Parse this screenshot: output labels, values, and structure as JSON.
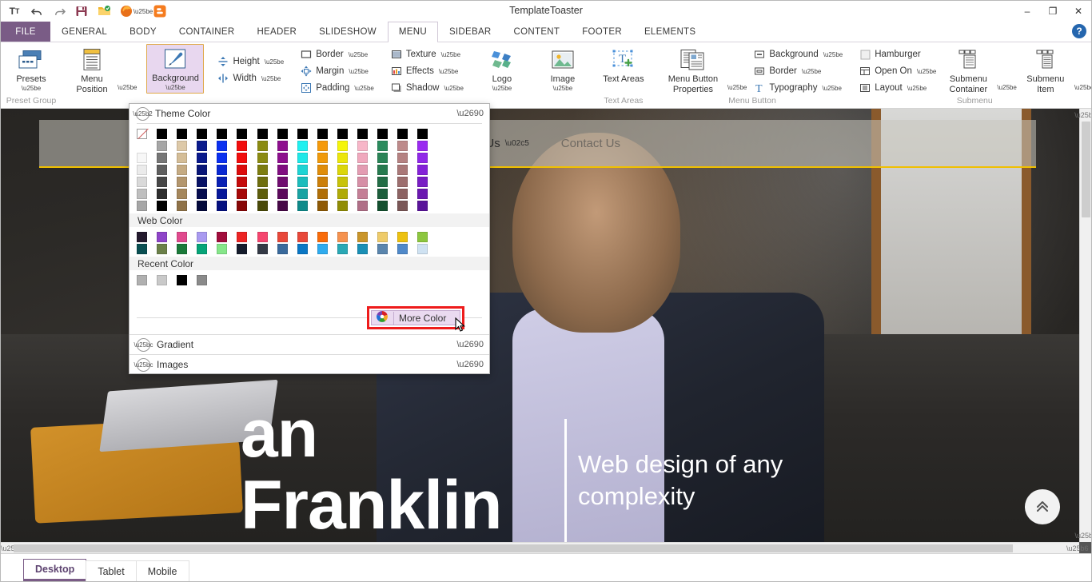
{
  "window": {
    "title": "TemplateToaster",
    "minimize": "–",
    "restore": "❐",
    "close": "✕",
    "help": "?"
  },
  "quick_access": [
    {
      "name": "text-size-icon",
      "label": "Tᴛ"
    },
    {
      "name": "undo-icon",
      "label": "↶"
    },
    {
      "name": "redo-icon",
      "label": "↷"
    },
    {
      "name": "save-icon",
      "label": "save"
    },
    {
      "name": "export-folder-icon",
      "label": "export"
    },
    {
      "name": "firefox-preview-icon",
      "label": "firefox"
    },
    {
      "name": "preview-dropdown-caret",
      "label": "▾"
    },
    {
      "name": "blogger-icon",
      "label": "b"
    }
  ],
  "ribbon_tabs": {
    "file": "FILE",
    "items": [
      {
        "label": "GENERAL",
        "active": false
      },
      {
        "label": "BODY",
        "active": false
      },
      {
        "label": "CONTAINER",
        "active": false
      },
      {
        "label": "HEADER",
        "active": false
      },
      {
        "label": "SLIDESHOW",
        "active": false
      },
      {
        "label": "MENU",
        "active": true
      },
      {
        "label": "SIDEBAR",
        "active": false
      },
      {
        "label": "CONTENT",
        "active": false
      },
      {
        "label": "FOOTER",
        "active": false
      },
      {
        "label": "ELEMENTS",
        "active": false
      }
    ]
  },
  "ribbon_groups": [
    {
      "label": "Preset Group",
      "buttons": [
        {
          "label": "Presets",
          "caret": true
        }
      ]
    },
    {
      "label": "",
      "buttons": [
        {
          "label": "Menu Position",
          "caret": true
        }
      ]
    },
    {
      "label": "",
      "buttons": [
        {
          "label": "Background",
          "caret": true,
          "selected": true
        }
      ]
    },
    {
      "label": "",
      "small": [
        {
          "label": "Height",
          "caret": true
        },
        {
          "label": "Width",
          "caret": true
        }
      ]
    },
    {
      "label": "",
      "small": [
        {
          "label": "Border",
          "caret": true
        },
        {
          "label": "Margin",
          "caret": true
        },
        {
          "label": "Padding",
          "caret": true
        }
      ]
    },
    {
      "label": "",
      "small": [
        {
          "label": "Texture",
          "caret": true
        },
        {
          "label": "Effects",
          "caret": true
        },
        {
          "label": "Shadow",
          "caret": true
        }
      ]
    },
    {
      "label": "",
      "buttons": [
        {
          "label": "Logo",
          "caret": true
        }
      ]
    },
    {
      "label": "",
      "buttons": [
        {
          "label": "Image",
          "caret": true
        }
      ]
    },
    {
      "label": "Text Areas",
      "buttons": [
        {
          "label": "Text Areas",
          "caret": false
        }
      ]
    },
    {
      "label": "Menu Button",
      "buttons": [
        {
          "label": "Menu Button Properties",
          "caret": true
        }
      ],
      "small": [
        {
          "label": "Background",
          "caret": true
        },
        {
          "label": "Border",
          "caret": true
        },
        {
          "label": "Typography",
          "caret": true
        }
      ]
    },
    {
      "label": "Submenu",
      "small": [
        {
          "label": "Hamburger",
          "caret": false
        },
        {
          "label": "Open On",
          "caret": true
        },
        {
          "label": "Layout",
          "caret": true
        }
      ],
      "buttons": [
        {
          "label": "Submenu Container",
          "caret": true
        },
        {
          "label": "Submenu Item",
          "caret": true
        }
      ]
    }
  ],
  "color_panel": {
    "theme_color": {
      "title": "Theme Color"
    },
    "web_color": {
      "title": "Web Color"
    },
    "recent_color": {
      "title": "Recent Color"
    },
    "more_color": {
      "label": "More Color",
      "icon": "color-wheel-icon",
      "highlight_color": "#ee1c1c"
    },
    "gradient": {
      "title": "Gradient"
    },
    "images": {
      "title": "Images"
    },
    "theme_swatches": [
      [
        "none",
        "#000000",
        "#000000",
        "#000000",
        "#000000",
        "#000000",
        "#000000",
        "#000000",
        "#000000",
        "#000000",
        "#000000",
        "#000000",
        "#000000",
        "#000000",
        "#000000"
      ],
      [
        "",
        "#a6a6a6",
        "#ddc9a8",
        "#0a1a8c",
        "#0b30f0",
        "#f20d0d",
        "#8b8b12",
        "#8e0f8e",
        "#1ff0f0",
        "#f59a0b",
        "#f5f50b",
        "#f7b6c8",
        "#2b8b5d",
        "#bd8a8a",
        "#9a2bf0"
      ],
      [
        "#f7f7f7",
        "#767676",
        "#d4bd97",
        "#0a1a8c",
        "#0b30f0",
        "#f20d0d",
        "#8b8b12",
        "#8e0f8e",
        "#1fe8e8",
        "#f09a0b",
        "#ece60b",
        "#f0a8bd",
        "#2b8457",
        "#b58282",
        "#9028e8"
      ],
      [
        "#ebebeb",
        "#5f5f5f",
        "#c5ab83",
        "#091678",
        "#0a28d2",
        "#dd0c0c",
        "#7d7d10",
        "#800d80",
        "#1ed4d4",
        "#e08d0a",
        "#dcd60a",
        "#e39cb2",
        "#277a4f",
        "#a97878",
        "#8422d8"
      ],
      [
        "#d9d9d9",
        "#474747",
        "#b3966d",
        "#081266",
        "#0920b4",
        "#c50b0b",
        "#6e6e0e",
        "#700c70",
        "#1cbcbc",
        "#cc7f09",
        "#c8c309",
        "#d68fa6",
        "#236d46",
        "#9c6e6e",
        "#781dc4"
      ],
      [
        "#bfbfbf",
        "#2e2e2e",
        "#a5875c",
        "#060d4f",
        "#07189a",
        "#a50909",
        "#5d5d0c",
        "#5c0a5c",
        "#19a3a3",
        "#b06f08",
        "#b0ab08",
        "#c47f96",
        "#1d5e3c",
        "#8c6363",
        "#6a18b0"
      ],
      [
        "#a6a6a6",
        "#000000",
        "#8f7248",
        "#040a3c",
        "#051080",
        "#870707",
        "#4a4a09",
        "#470847",
        "#0f8a8a",
        "#8f5a06",
        "#918d06",
        "#b06f87",
        "#14502f",
        "#7a5757",
        "#5a149a"
      ]
    ],
    "web_swatches": [
      [
        "#241a2e",
        "#8e44c8",
        "#e04a8e",
        "#a99af0",
        "#a10d3c",
        "#ec2424",
        "#f5456e",
        "#e8483a",
        "#e8483a",
        "#f96b0a",
        "#f5924f",
        "#c9952a",
        "#eecb6a",
        "#ecc110",
        "#8cc63f"
      ],
      [
        "#0a4f52",
        "#6b8049",
        "#1b7a3a",
        "#07a478",
        "#86e68a",
        "#151c2c",
        "#343a46",
        "#3a6a9c",
        "#0a77c4",
        "#2fabee",
        "#2aa8b5",
        "#1a8fb5",
        "#5a85ad",
        "#5089c9",
        "#cfe2f2"
      ]
    ],
    "recent_swatches": [
      "#b0b0b0",
      "#c9c9c9",
      "#000000",
      "#8a8a8a"
    ]
  },
  "preview": {
    "site_nav": [
      {
        "label": "About Us",
        "has_caret": true,
        "faded": false
      },
      {
        "label": "Contact Us",
        "has_caret": false,
        "faded": true
      }
    ],
    "hero_name": "Franklin",
    "hero_name_top": "an",
    "hero_subtitle": "Web design of any complexity",
    "scroll_top_icon": "chevron-double-up-icon"
  },
  "device_tabs": [
    {
      "label": "Desktop",
      "active": true
    },
    {
      "label": "Tablet",
      "active": false
    },
    {
      "label": "Mobile",
      "active": false
    }
  ],
  "colors": {
    "accent": "#7a5c86",
    "selected_button_bg": "#e8d7ef",
    "highlight_red": "#ee1c1c",
    "site_accent_yellow": "#f0c000"
  }
}
